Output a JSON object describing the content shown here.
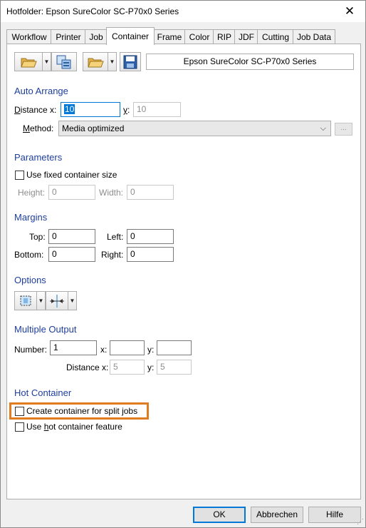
{
  "window": {
    "title": "Hotfolder: Epson SureColor SC-P70x0 Series",
    "close_symbol": "✕"
  },
  "tabs": [
    {
      "label": "Workflow"
    },
    {
      "label": "Printer"
    },
    {
      "label": "Job"
    },
    {
      "label": "Container",
      "active": true
    },
    {
      "label": "Frame"
    },
    {
      "label": "Color"
    },
    {
      "label": "RIP"
    },
    {
      "label": "JDF"
    },
    {
      "label": "Cutting"
    },
    {
      "label": "Job Data"
    }
  ],
  "toolbar": {
    "icons": [
      "open-folder-icon",
      "copy-icon",
      "open-folder-icon",
      "save-icon"
    ],
    "printer_name": "Epson SureColor SC-P70x0 Series",
    "dropdown_symbol": "▼"
  },
  "auto_arrange": {
    "title": "Auto Arrange",
    "distance_label_u": "D",
    "distance_label_rest": "istance x:",
    "distance_x": "10",
    "y_label_u": "y",
    "y_label_rest": ":",
    "distance_y": "10",
    "method_label_u": "M",
    "method_label_rest": "ethod:",
    "method_value": "Media optimized",
    "more_label": "...",
    "combo_arrow": "⌵"
  },
  "parameters": {
    "title": "Parameters",
    "fixed_size_label": "Use fixed container size",
    "height_label": "Height:",
    "height_value": "0",
    "width_label": "Width:",
    "width_value": "0"
  },
  "margins": {
    "title": "Margins",
    "top_label": "Top:",
    "top_value": "0",
    "left_label": "Left:",
    "left_value": "0",
    "bottom_label": "Bottom:",
    "bottom_value": "0",
    "right_label": "Right:",
    "right_value": "0"
  },
  "options": {
    "title": "Options",
    "icons": [
      "align-frame-icon",
      "center-align-icon"
    ]
  },
  "multiple_output": {
    "title": "Multiple Output",
    "number_label": "Number:",
    "number_value": "1",
    "x_label": "x:",
    "x_value": "",
    "y_label": "y:",
    "y_value": "",
    "distance_label": "Distance x:",
    "distance_x_value": "5",
    "distance_y_label": "y:",
    "distance_y_value": "5"
  },
  "hot_container": {
    "title": "Hot Container",
    "split_jobs_label": "Create container for split jobs",
    "hot_feature_label_pre": "Use ",
    "hot_feature_label_u": "h",
    "hot_feature_label_post": "ot container feature"
  },
  "buttons": {
    "ok": "OK",
    "cancel": "Abbrechen",
    "help": "Hilfe"
  },
  "colors": {
    "accent": "#0078d7",
    "section": "#1e3e9e",
    "highlight": "#e07b1f"
  }
}
